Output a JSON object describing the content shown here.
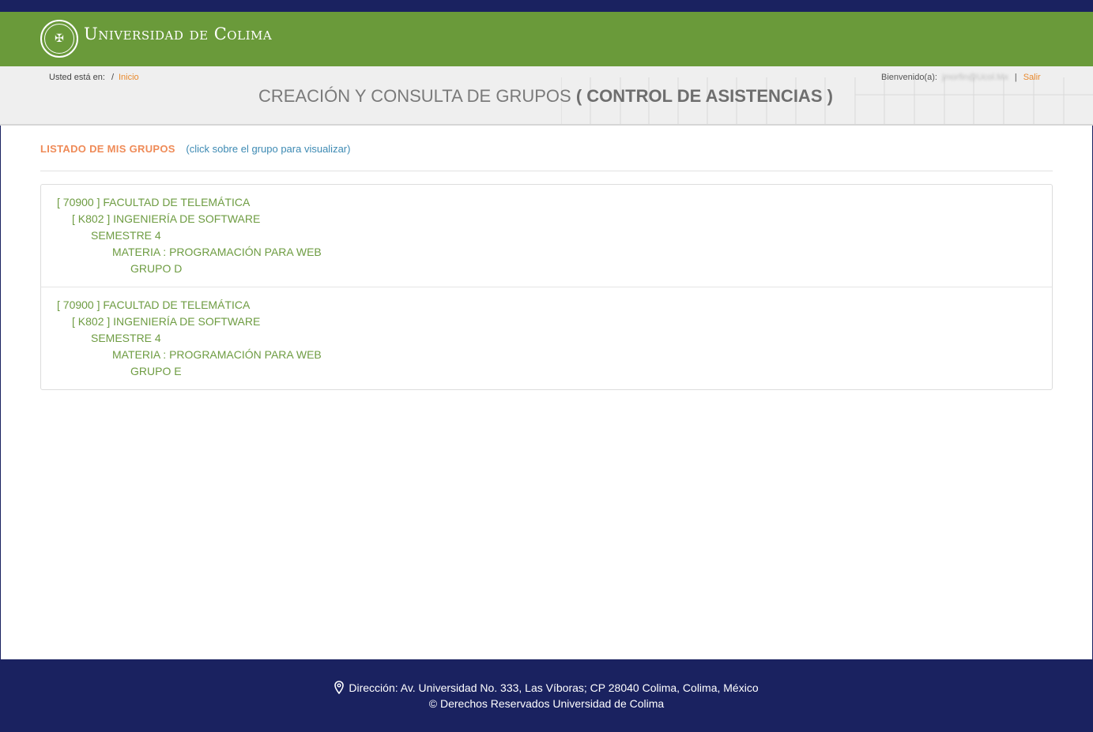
{
  "header": {
    "brand": "Universidad de Colima",
    "logo_icon": "university-crest-icon"
  },
  "subbar": {
    "breadcrumb_label": "Usted está en:",
    "breadcrumb_sep": "/",
    "breadcrumb_link": "Inicio",
    "welcome_label": "Bienvenido(a):",
    "welcome_user": "jmorfin@Ucol.Mx",
    "pipe": "|",
    "logout": "Salir",
    "title_main": "CREACIÓN Y CONSULTA DE GRUPOS",
    "title_strong": "( CONTROL DE ASISTENCIAS )"
  },
  "list": {
    "title": "LISTADO DE MIS GRUPOS",
    "hint": "(click sobre el grupo para visualizar)"
  },
  "groups": [
    {
      "faculty": "[ 70900 ] FACULTAD DE TELEMÁTICA",
      "program": "[ K802 ] INGENIERÍA DE SOFTWARE",
      "semester": "SEMESTRE 4",
      "subject": "MATERIA : PROGRAMACIÓN PARA WEB",
      "group": "GRUPO D"
    },
    {
      "faculty": "[ 70900 ] FACULTAD DE TELEMÁTICA",
      "program": "[ K802 ] INGENIERÍA DE SOFTWARE",
      "semester": "SEMESTRE 4",
      "subject": "MATERIA : PROGRAMACIÓN PARA WEB",
      "group": "GRUPO E"
    }
  ],
  "footer": {
    "address": "Dirección: Av. Universidad No. 333, Las Víboras; CP 28040 Colima, Colima, México",
    "copyright": "© Derechos Reservados Universidad de Colima",
    "pin_icon": "map-pin-icon"
  },
  "colors": {
    "navy": "#1a2260",
    "green": "#6a9a3a",
    "orange": "#e98a2e",
    "group_text": "#6e9c42"
  }
}
